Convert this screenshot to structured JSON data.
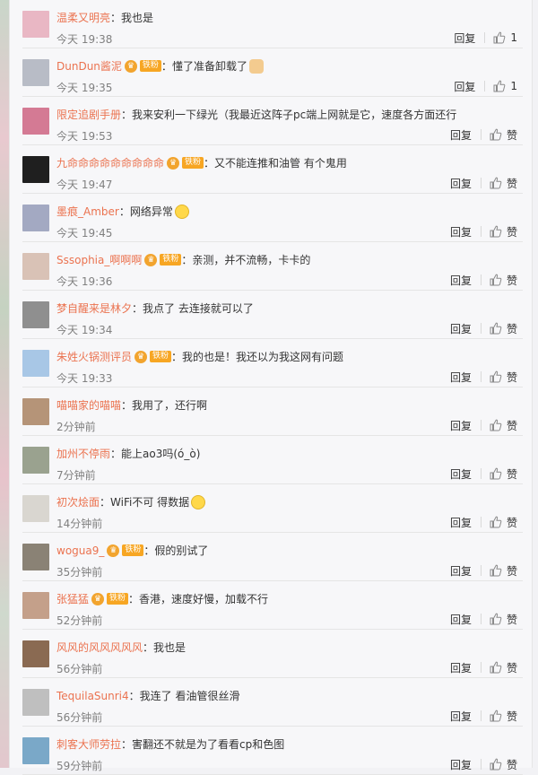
{
  "actions": {
    "reply_label": "回复",
    "like_label": "赞"
  },
  "colors": {
    "username": "#eb7350",
    "badge_gold": "#f7a623",
    "badge_iron": "#9ec9ea"
  },
  "comments": [
    {
      "user": "温柔又明亮",
      "text": "我也是",
      "time": "今天 19:38",
      "likes": "1",
      "badge": "",
      "emoji": ""
    },
    {
      "user": "DunDun酱泥",
      "text": "懂了准备卸载了",
      "time": "今天 19:35",
      "likes": "1",
      "badge": "铁粉",
      "emoji": "ok"
    },
    {
      "user": "限定追剧手册",
      "text": "我来安利一下绿光（我最近这阵子pc端上网就是它，速度各方面还行",
      "time": "今天 19:53",
      "likes": "",
      "badge": "",
      "emoji": ""
    },
    {
      "user": "九命命命命命命命命命",
      "text": "又不能连推和油管 有个鬼用",
      "time": "今天 19:47",
      "likes": "",
      "badge": "铁粉",
      "emoji": ""
    },
    {
      "user": "墨痕_Amber",
      "text": "网络异常",
      "time": "今天 19:45",
      "likes": "",
      "badge": "",
      "emoji": "laugh"
    },
    {
      "user": "Sssophia_啊啊啊",
      "text": "亲测，并不流畅，卡卡的",
      "time": "今天 19:36",
      "likes": "",
      "badge": "铁粉",
      "emoji": ""
    },
    {
      "user": "梦自醒来是林夕",
      "text": "我点了 去连接就可以了",
      "time": "今天 19:34",
      "likes": "",
      "badge": "",
      "emoji": ""
    },
    {
      "user": "朱姓火锅测评员",
      "text": "我的也是！我还以为我这网有问题",
      "time": "今天 19:33",
      "likes": "",
      "badge": "铁粉",
      "emoji": ""
    },
    {
      "user": "喵喵家的喵喵",
      "text": "我用了，还行啊",
      "time": "2分钟前",
      "likes": "",
      "badge": "",
      "emoji": ""
    },
    {
      "user": "加州不停雨",
      "text": "能上ao3吗(ó_ò)",
      "time": "7分钟前",
      "likes": "",
      "badge": "",
      "emoji": ""
    },
    {
      "user": "初次烩面",
      "text": "WiFi不可 得数据",
      "time": "14分钟前",
      "likes": "",
      "badge": "",
      "emoji": "laugh"
    },
    {
      "user": "wogua9_",
      "text": "假的别试了",
      "time": "35分钟前",
      "likes": "",
      "badge": "铁粉",
      "emoji": ""
    },
    {
      "user": "张猛猛",
      "text": "香港，速度好慢，加载不行",
      "time": "52分钟前",
      "likes": "",
      "badge": "铁粉",
      "emoji": ""
    },
    {
      "user": "风风的风风风风风",
      "text": "我也是",
      "time": "56分钟前",
      "likes": "",
      "badge": "",
      "emoji": ""
    },
    {
      "user": "TequilaSunri4",
      "text": "我连了 看油管很丝滑",
      "time": "56分钟前",
      "likes": "",
      "badge": "",
      "emoji": ""
    },
    {
      "user": "刺客大师劳拉",
      "text": "害翻还不就是为了看看cp和色图",
      "time": "59分钟前",
      "likes": "",
      "badge": "",
      "emoji": ""
    }
  ]
}
